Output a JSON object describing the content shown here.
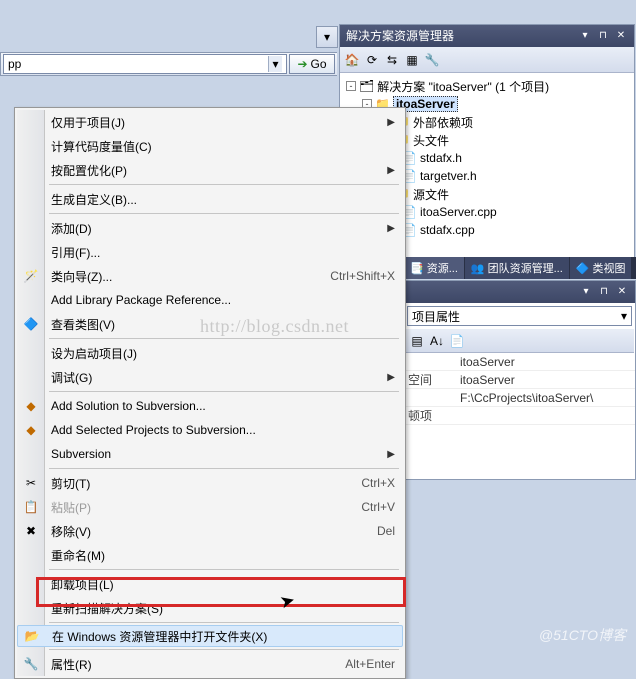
{
  "solution_explorer": {
    "title": "解决方案资源管理器",
    "toolbar_icons": [
      "home-icon",
      "back-icon",
      "forward-icon",
      "refresh-icon",
      "properties-icon",
      "show-all-icon"
    ],
    "nodes": {
      "solution": "解决方案 \"itoaServer\" (1 个项目)",
      "project": "itoaServer",
      "ext_deps": "外部依赖项",
      "headers": "头文件",
      "h1": "stdafx.h",
      "h2": "targetver.h",
      "sources": "源文件",
      "c1": "itoaServer.cpp",
      "c2": "stdafx.cpp"
    }
  },
  "tabs": {
    "t1": "资源...",
    "t2": "团队资源管理...",
    "t3": "类视图"
  },
  "combo": {
    "value": "pp",
    "go": "Go"
  },
  "menu": {
    "project_only": "仅用于项目(J)",
    "calc_metrics": "计算代码度量值(C)",
    "cfg_opt": "按配置优化(P)",
    "build_custom": "生成自定义(B)...",
    "add": "添加(D)",
    "reference": "引用(F)...",
    "class_wiz": "类向导(Z)...",
    "class_wiz_sc": "Ctrl+Shift+X",
    "add_lib": "Add Library Package Reference...",
    "view_class": "查看类图(V)",
    "set_startup": "设为启动项目(J)",
    "debug": "调试(G)",
    "add_sln_svn": "Add Solution to Subversion...",
    "add_proj_svn": "Add Selected Projects to Subversion...",
    "svn": "Subversion",
    "cut": "剪切(T)",
    "cut_sc": "Ctrl+X",
    "paste": "粘贴(P)",
    "paste_sc": "Ctrl+V",
    "remove": "移除(V)",
    "remove_sc": "Del",
    "rename": "重命名(M)",
    "unload": "卸载项目(L)",
    "rescan": "重新扫描解决方案(S)",
    "open_folder": "在 Windows 资源管理器中打开文件夹(X)",
    "props": "属性(R)",
    "props_sc": "Alt+Enter"
  },
  "properties": {
    "title": "项目属性",
    "rows": [
      {
        "k": "",
        "v": "itoaServer"
      },
      {
        "k": "空间",
        "v": "itoaServer"
      },
      {
        "k": "",
        "v": "F:\\CcProjects\\itoaServer\\"
      },
      {
        "k": "顿项",
        "v": ""
      }
    ]
  },
  "watermark_blog": "http://blog.csdn.net",
  "credit": "@51CTO博客"
}
